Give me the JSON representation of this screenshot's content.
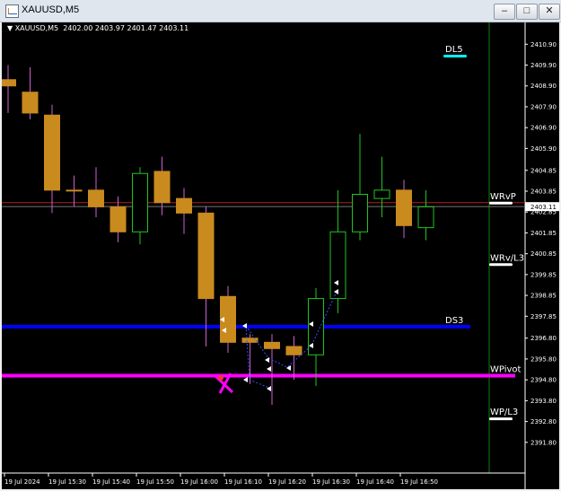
{
  "window": {
    "title": "XAUUSD,M5",
    "minimize_icon": "minimize-icon",
    "maximize_icon": "maximize-icon",
    "close_icon": "close-icon"
  },
  "header": {
    "symbol_timeframe": "XAUUSD,M5",
    "ohlc": "2402.00 2403.97 2401.47 2403.11"
  },
  "colors": {
    "background": "#000000",
    "bull_candle": "#000000",
    "bear_candle": "#c98a1e",
    "bull_outline": "#22c322",
    "bear_outline": "#c98a1e",
    "wick": "#d060d0",
    "support_line": "#0000ff",
    "pivot_line": "#ff00ff",
    "dl5_mark": "#00ffff",
    "price_tag": "#ffffff",
    "vline": "#0f7f0f"
  },
  "chart_data": {
    "type": "candlestick",
    "symbol": "XAUUSD",
    "timeframe": "M5",
    "current_price": "2403.11",
    "ylim": [
      2390.5,
      2411.3
    ],
    "y_ticks": [
      "2410.90",
      "2409.90",
      "2408.90",
      "2407.90",
      "2406.90",
      "2405.90",
      "2404.85",
      "2403.85",
      "2402.85",
      "2401.85",
      "2400.85",
      "2399.85",
      "2398.85",
      "2397.85",
      "2396.80",
      "2395.80",
      "2394.80",
      "2393.80",
      "2392.80",
      "2391.80"
    ],
    "x_ticks": [
      "19 Jul 2024",
      "19 Jul 15:30",
      "19 Jul 15:40",
      "19 Jul 15:50",
      "19 Jul 16:00",
      "19 Jul 16:10",
      "19 Jul 16:20",
      "19 Jul 16:30",
      "19 Jul 16:40",
      "19 Jul 16:50"
    ],
    "candles": [
      {
        "o": 2409.2,
        "h": 2409.9,
        "l": 2407.6,
        "c": 2408.9
      },
      {
        "o": 2408.6,
        "h": 2409.8,
        "l": 2407.3,
        "c": 2407.6
      },
      {
        "o": 2407.5,
        "h": 2408.0,
        "l": 2402.8,
        "c": 2403.9
      },
      {
        "o": 2403.9,
        "h": 2404.6,
        "l": 2403.1,
        "c": 2403.9
      },
      {
        "o": 2403.9,
        "h": 2405.0,
        "l": 2402.6,
        "c": 2403.1
      },
      {
        "o": 2403.1,
        "h": 2403.6,
        "l": 2401.4,
        "c": 2401.9
      },
      {
        "o": 2401.9,
        "h": 2405.0,
        "l": 2401.3,
        "c": 2404.7
      },
      {
        "o": 2404.8,
        "h": 2405.5,
        "l": 2402.7,
        "c": 2403.3
      },
      {
        "o": 2403.5,
        "h": 2404.0,
        "l": 2401.8,
        "c": 2402.8
      },
      {
        "o": 2402.8,
        "h": 2403.1,
        "l": 2396.4,
        "c": 2398.7
      },
      {
        "o": 2398.8,
        "h": 2399.3,
        "l": 2396.1,
        "c": 2396.6
      },
      {
        "o": 2396.8,
        "h": 2397.0,
        "l": 2394.6,
        "c": 2396.6
      },
      {
        "o": 2396.6,
        "h": 2397.0,
        "l": 2393.6,
        "c": 2396.3
      },
      {
        "o": 2396.4,
        "h": 2396.9,
        "l": 2394.8,
        "c": 2396.0
      },
      {
        "o": 2396.0,
        "h": 2399.2,
        "l": 2394.5,
        "c": 2398.7
      },
      {
        "o": 2398.7,
        "h": 2403.9,
        "l": 2398.0,
        "c": 2401.9
      },
      {
        "o": 2401.9,
        "h": 2406.6,
        "l": 2401.5,
        "c": 2403.7
      },
      {
        "o": 2403.5,
        "h": 2405.5,
        "l": 2402.6,
        "c": 2403.9
      },
      {
        "o": 2403.9,
        "h": 2404.4,
        "l": 2401.6,
        "c": 2402.2
      },
      {
        "o": 2402.1,
        "h": 2403.9,
        "l": 2401.5,
        "c": 2403.1
      }
    ],
    "levels": [
      {
        "label": "DL5",
        "price": 2410.35,
        "color": "#00ffff",
        "line": false
      },
      {
        "label": "WRvP",
        "price": 2403.3,
        "color": "#ffffff",
        "line": false
      },
      {
        "label": "WRv/L3",
        "price": 2400.35,
        "color": "#ffffff",
        "line": false
      },
      {
        "label": "DS3",
        "price": 2397.35,
        "color": "#0000ff",
        "line": true
      },
      {
        "label": "WPivot",
        "price": 2395.0,
        "color": "#ff00ff",
        "line": true
      },
      {
        "label": "WP/L3",
        "price": 2392.95,
        "color": "#ffffff",
        "line": false
      }
    ]
  }
}
